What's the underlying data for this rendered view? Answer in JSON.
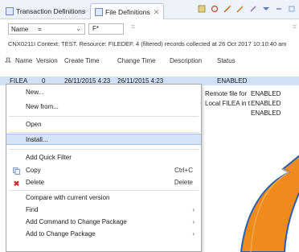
{
  "tabs": [
    {
      "label": "Transaction Definitions",
      "active": false
    },
    {
      "label": "File Definitions",
      "active": true,
      "close": "✕"
    }
  ],
  "filter": {
    "field": "Name",
    "operator": "=",
    "value": "F*"
  },
  "context_line": "CNX0211I Context: TEST. Resource: FILEDEF. 4 (filtered) records collected at 26 Oct 2017 10:10:40 am",
  "table": {
    "columns": [
      "Name",
      "Version",
      "Create Time",
      "Change Time",
      "Description",
      "Status"
    ],
    "rows": [
      {
        "name": "FILEA",
        "version": "0",
        "create": "26/11/2015 4:23",
        "change": "26/11/2015 4:23",
        "desc": "",
        "status": "ENABLED"
      },
      {
        "name": "",
        "version": "",
        "create": "",
        "change": "",
        "desc": "Remote file for",
        "status": "ENABLED"
      },
      {
        "name": "",
        "version": "",
        "create": "",
        "change": "",
        "desc": "Local FILEA in t",
        "status": "ENABLED"
      },
      {
        "name": "",
        "version": "",
        "create": "",
        "change": "",
        "desc": "",
        "status": "ENABLED"
      }
    ]
  },
  "menu": {
    "new": "New...",
    "new_from": "New from...",
    "open": "Open",
    "install": "Install...",
    "add_quick_filter": "Add Quick Filter",
    "copy": "Copy",
    "copy_accel": "Ctrl+C",
    "delete": "Delete",
    "delete_accel": "Delete",
    "compare": "Compare with current version",
    "find": "Find",
    "add_command": "Add Command to Change Package",
    "add_change": "Add to Change Package",
    "submenu_glyph": "›"
  },
  "colors": {
    "selection": "#cfe0f7",
    "highlight": "#d4e3f8",
    "arrow_fill": "#f08a1c",
    "arrow_stroke": "#2a5fb0"
  }
}
